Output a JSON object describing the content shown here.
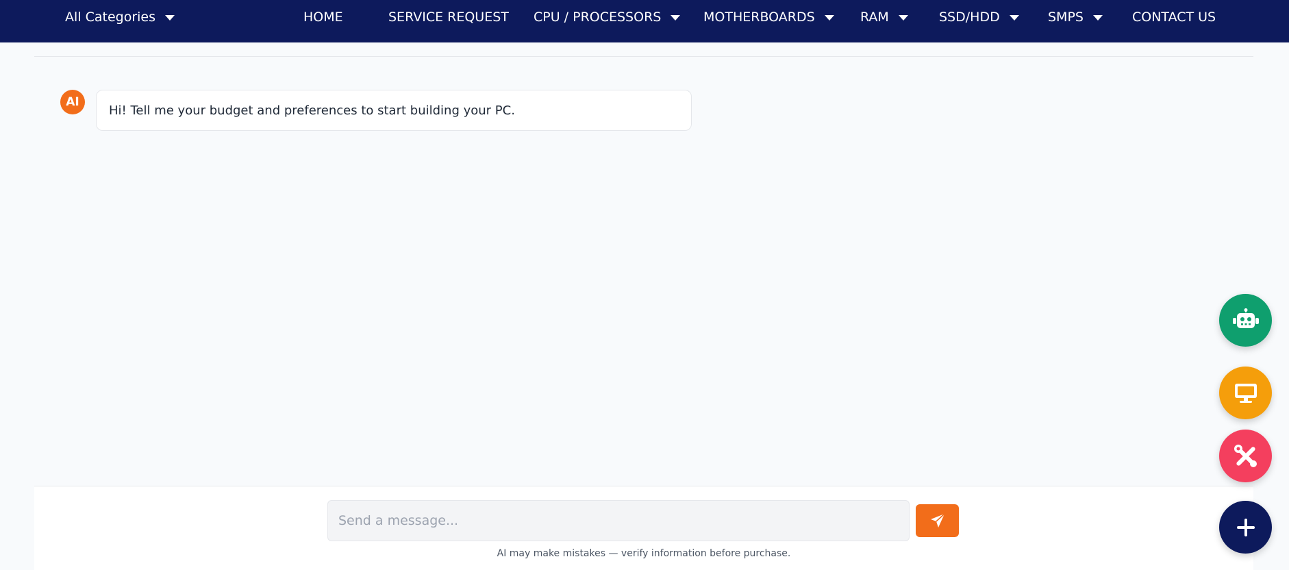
{
  "nav": {
    "categories_label": "All Categories",
    "items": [
      {
        "label": "HOME",
        "dropdown": false
      },
      {
        "label": "SERVICE REQUEST",
        "dropdown": false
      },
      {
        "label": "CPU / PROCESSORS",
        "dropdown": true
      },
      {
        "label": "MOTHERBOARDS",
        "dropdown": true
      },
      {
        "label": "RAM",
        "dropdown": true
      },
      {
        "label": "SSD/HDD",
        "dropdown": true
      },
      {
        "label": "SMPS",
        "dropdown": true
      },
      {
        "label": "CONTACT US",
        "dropdown": false
      }
    ]
  },
  "chat": {
    "avatar_label": "AI",
    "message": "Hi! Tell me your budget and preferences to start building your PC."
  },
  "composer": {
    "placeholder": "Send a message...",
    "disclaimer": "AI may make mistakes — verify information before purchase."
  },
  "fabs": [
    {
      "icon": "robot-icon",
      "color": "#0f9f6e"
    },
    {
      "icon": "monitor-icon",
      "color": "#f59e0b"
    },
    {
      "icon": "tools-icon",
      "color": "#f43f5e"
    },
    {
      "icon": "plus-icon",
      "color": "#0d1a5c"
    }
  ],
  "colors": {
    "nav_bg": "#0d1a5c",
    "accent": "#f26d1a",
    "page_bg": "#f8fafc"
  }
}
